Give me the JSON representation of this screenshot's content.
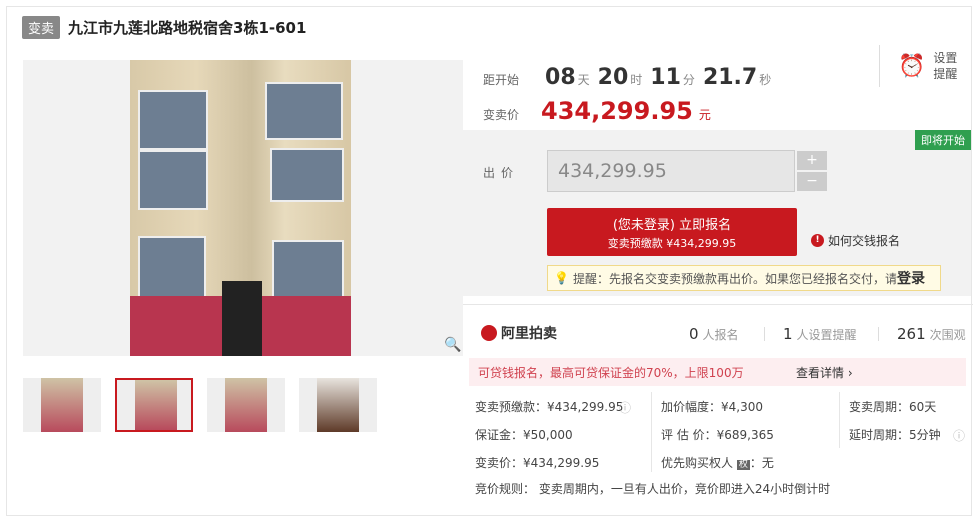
{
  "header": {
    "tag": "变卖",
    "title": "九江市九莲北路地税宿舍3栋1-601"
  },
  "countdown": {
    "label": "距开始",
    "days": "08",
    "days_unit": "天",
    "hours": "20",
    "hours_unit": "时",
    "minutes": "11",
    "minutes_unit": "分",
    "seconds": "21.7",
    "seconds_unit": "秒"
  },
  "price": {
    "label": "变卖价",
    "value": "434,299.95",
    "unit": "元"
  },
  "reminder": {
    "label": "设置提醒"
  },
  "badge": "即将开始",
  "bid": {
    "label": "出价",
    "value": "434,299.95",
    "plus": "+",
    "minus": "−",
    "signup_line1": "(您未登录) 立即报名",
    "signup_line2": "变卖预缴款 ¥434,299.95",
    "howto": "如何交钱报名",
    "tip": "提醒：先报名交变卖预缴款再出价。如果您已经报名交付，请",
    "tip_login": "登录"
  },
  "stats": {
    "brand": "阿里拍卖",
    "signups": "0",
    "signups_label": "人报名",
    "reminders": "1",
    "reminders_label": "人设置提醒",
    "views": "261",
    "views_label": "次围观"
  },
  "loan": {
    "text": "可贷钱报名，最高可贷保证金的70%，上限100万",
    "detail": "查看详情 ›"
  },
  "details": {
    "deposit": "变卖预缴款：¥434,299.95",
    "increment": "加价幅度：¥4,300",
    "period": "变卖周期：60天",
    "guarantee": "保证金：¥50,000",
    "appraisal": "评 估 价：¥689,365",
    "delay": "延时周期：5分钟",
    "sale_price": "变卖价：¥434,299.95",
    "priority": "优先购买权人",
    "priority_value": "无",
    "rule": "竞价规则： 变卖周期内，一旦有人出价，竞价即进入24小时倒计时"
  }
}
